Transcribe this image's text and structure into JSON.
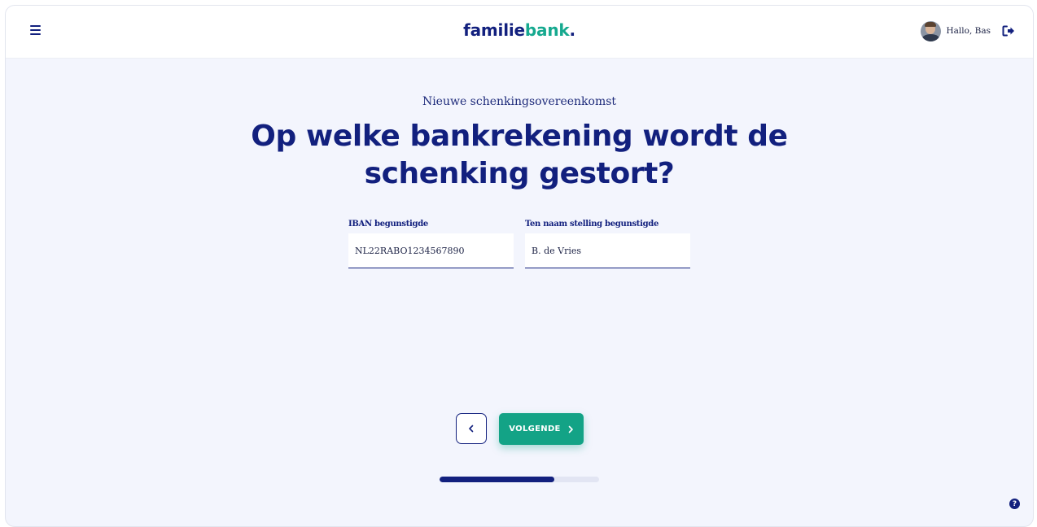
{
  "header": {
    "menu_icon": "hamburger-menu-icon",
    "logo": {
      "part1": "familie",
      "part2": "bank",
      "dot": "."
    },
    "greeting": "Hallo, Bas",
    "logout_icon": "sign-out-icon"
  },
  "page": {
    "subtitle": "Nieuwe schenkingsovereenkomst",
    "title": "Op welke bankrekening wordt de schenking gestort?"
  },
  "form": {
    "iban": {
      "label": "IBAN begunstigde",
      "value": "NL22RABO1234567890"
    },
    "name": {
      "label": "Ten naam stelling begunstigde",
      "value": "B. de Vries"
    }
  },
  "navigation": {
    "back_icon": "chevron-left-icon",
    "next_label": "VOLGENDE",
    "next_icon": "chevron-right-icon"
  },
  "progress": {
    "fraction": 0.72
  },
  "help_icon": "question-circle-icon",
  "colors": {
    "primary": "#12207e",
    "accent": "#13a386",
    "background": "#f3f5fd"
  }
}
